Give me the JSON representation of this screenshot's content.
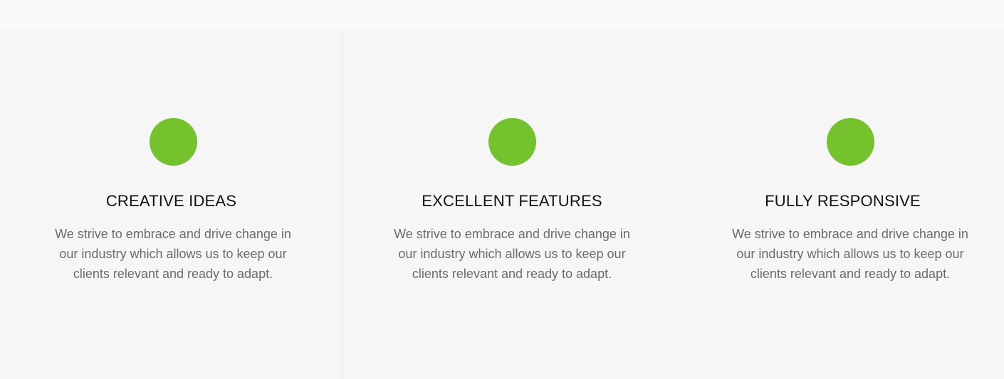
{
  "theme": {
    "accent": "#74c22c",
    "background": "#f6f6f6",
    "title_color": "#111111",
    "text_color": "#6b6b6b"
  },
  "features": [
    {
      "icon": "circle-icon",
      "title": "CREATIVE IDEAS",
      "text": "We strive to embrace and drive change in our industry which allows us to keep our clients relevant and ready to adapt."
    },
    {
      "icon": "circle-icon",
      "title": "EXCELLENT FEATURES",
      "text": "We strive to embrace and drive change in our industry which allows us to keep our clients relevant and ready to adapt."
    },
    {
      "icon": "circle-icon",
      "title": "FULLY RESPONSIVE",
      "text": "We strive to embrace and drive change in our industry which allows us to keep our clients relevant and ready to adapt."
    }
  ]
}
